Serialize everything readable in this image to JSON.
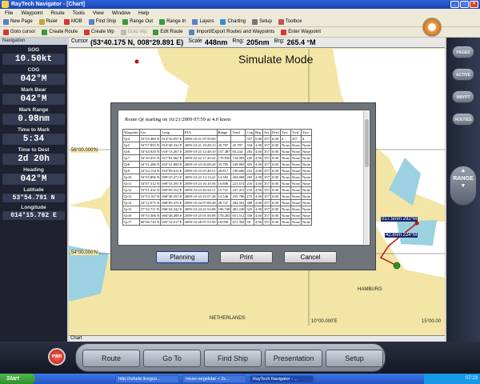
{
  "window": {
    "title": "RayTech Navigator - [Chart]"
  },
  "menu": [
    "File",
    "Waypoint",
    "Route",
    "Tools",
    "View",
    "Window",
    "Help"
  ],
  "toolbar1": [
    {
      "label": "New Page",
      "icon": "new-page-icon"
    },
    {
      "label": "Ruler",
      "icon": "ruler-icon"
    },
    {
      "label": "MOB",
      "icon": "mob-icon"
    },
    {
      "label": "Find Ship",
      "icon": "find-ship-icon"
    },
    {
      "label": "Range Out",
      "icon": "range-out-icon"
    },
    {
      "label": "Range In",
      "icon": "range-in-icon"
    },
    {
      "label": "Layers",
      "icon": "layers-icon"
    },
    {
      "label": "Charting",
      "icon": "charting-icon"
    },
    {
      "label": "Setup",
      "icon": "setup-icon"
    },
    {
      "label": "Toolbox",
      "icon": "toolbox-icon"
    }
  ],
  "toolbar2": [
    {
      "label": "Goto cursor",
      "icon": "goto-cursor-icon",
      "disabled": false
    },
    {
      "label": "Create Route",
      "icon": "create-route-icon",
      "disabled": false
    },
    {
      "label": "Create Wp",
      "icon": "create-wp-icon",
      "disabled": false
    },
    {
      "label": "Goto Wp",
      "icon": "goto-wp-icon",
      "disabled": true
    },
    {
      "label": "Edit Route",
      "icon": "edit-route-icon",
      "disabled": false
    },
    {
      "label": "Import/Export Routes and Waypoints",
      "icon": "import-export-icon",
      "disabled": false
    },
    {
      "label": "Enter Waypoint",
      "icon": "enter-waypoint-icon",
      "disabled": false
    }
  ],
  "navigation": {
    "header": "Navigation",
    "items": [
      {
        "label": "SOG",
        "value": "10.50kt"
      },
      {
        "label": "COG",
        "value": "042°M"
      },
      {
        "label": "Mark Bear",
        "value": "042°M"
      },
      {
        "label": "Mark Range",
        "value": "0.98nm"
      },
      {
        "label": "Time to Mark",
        "value": "5:34"
      },
      {
        "label": "Time to Dest",
        "value": "2d 20h"
      },
      {
        "label": "Heading",
        "value": "042°M"
      },
      {
        "label": "Latitude",
        "value": "53°54.791 N",
        "small": true
      },
      {
        "label": "Longitude",
        "value": "014°15.782 E",
        "small": true
      }
    ]
  },
  "chartbar": {
    "cursor_label": "Cursor",
    "cursor_value": "(53°40.175 N,",
    "cursor_lon": "008°29.891 E)",
    "scale_label": "Scale",
    "scale_value": "448nm",
    "rng_label": "Rng:",
    "rng_value": "205nm",
    "brg_label": "Brg:",
    "brg_value": "265.4 °M"
  },
  "chart": {
    "mode": "Simulate Mode",
    "lat_labels": [
      "56°00.000'N",
      "54°00.000'N"
    ],
    "lon_labels": [
      "10°00.000'E",
      "15°00.00"
    ],
    "place_labels": [
      "NETHERLANDS",
      "HAMBURG"
    ],
    "boat_labels": [
      "017.5mm 292°M",
      "42.8nm 224°M"
    ],
    "footer": "Chart"
  },
  "report": {
    "title": "Route Qr starting on 10/21/2009 07:59 at 4.0 knots",
    "columns": [
      "Waypoint",
      "Lat",
      "Long",
      "ETA",
      "Range",
      "Total",
      "Cog",
      "Brg",
      "Set",
      "Drift",
      "Tws",
      "Twd",
      "Twa"
    ],
    "rows": [
      [
        "Qr4",
        "53°55.480 N",
        "014°16.957 E",
        "2009-10-21 07:59:00",
        "",
        "",
        "357",
        "0.00",
        "357",
        "0.00",
        "0",
        "357",
        "0"
      ],
      [
        "Qr5",
        "54°57.855 N",
        "014°48.334 E",
        "2009-10-21 19:28:13",
        "45.787",
        "45.787",
        "334",
        "4.00",
        "357",
        "0.00",
        "None",
        "None",
        "None"
      ],
      [
        "Qr6",
        "54°44.920 N",
        "010°13.267 E",
        "2009-10-23 12:48:10",
        "157.487",
        "83.244",
        "282",
        "4.00",
        "357",
        "0.00",
        "None",
        "None",
        "None"
      ],
      [
        "Qr7",
        "54°30.455 N",
        "011°02.662 E",
        "2009-10-22 17:20:22",
        "170.839",
        "134.083",
        "220",
        "4.00",
        "357",
        "0.00",
        "None",
        "None",
        "None"
      ],
      [
        "Qr8",
        "54°31.286 N",
        "010°41.808 E",
        "2009-10-23 02:08:28",
        "35.785",
        "169.869",
        "303",
        "4.00",
        "357",
        "0.00",
        "None",
        "None",
        "None"
      ],
      [
        "Qr9",
        "54°22.154 N",
        "010°09.614 E",
        "2009-10-23 07:40:51",
        "20.817",
        "190.686",
        "241",
        "4.00",
        "357",
        "0.00",
        "None",
        "None",
        "None"
      ],
      [
        "Qr10",
        "54°55.896 N",
        "009°45.272 E",
        "2009-10-23 13:13:41",
        "14.382",
        "204.868",
        "265",
        "4.00",
        "357",
        "0.00",
        "None",
        "None",
        "None"
      ],
      [
        "Qr11",
        "54°07.312 N",
        "009°33.591 E",
        "2009-10-23 16:10:56",
        "16.806",
        "221.674",
        "216",
        "4.00",
        "357",
        "0.00",
        "None",
        "None",
        "None"
      ],
      [
        "Qr12",
        "53°51.432 N",
        "009°09.352 E",
        "2009-10-23 20:34:11",
        "15.741",
        "237.415",
        "210",
        "4.00",
        "357",
        "0.00",
        "None",
        "None",
        "None"
      ],
      [
        "Qr13",
        "53°53.167 N",
        "008°48.355 E",
        "2009-10-23 23:57:28",
        "13.546",
        "255.786",
        "275",
        "4.00",
        "357",
        "0.00",
        "None",
        "None",
        "None"
      ],
      [
        "Qr14",
        "54°12.075 N",
        "008°09.476 E",
        "2009-10-24 07:08:48",
        "28.747",
        "284.501",
        "308",
        "4.00",
        "357",
        "0.00",
        "None",
        "None",
        "None"
      ],
      [
        "Qr15",
        "57°32.711 N",
        "006°44.342 E",
        "2009-10-24 21:54:08",
        "196.748",
        "481.249",
        "325",
        "4.00",
        "357",
        "0.00",
        "None",
        "None",
        "None"
      ],
      [
        "Qr16",
        "59°53.306 N",
        "004°48.498 E",
        "2009-10-25 01:56:08",
        "170.263",
        "651.512",
        "358",
        "4.00",
        "357",
        "0.00",
        "None",
        "None",
        "None"
      ],
      [
        "Qr17",
        "60°06.743 N",
        "005°12.017 E",
        "2009-10-28 07:53:56",
        "18.090",
        "671.302",
        "58",
        "4.00",
        "357",
        "0.00",
        "None",
        "None",
        "None"
      ]
    ],
    "buttons": [
      "Planning",
      "Print",
      "Cancel"
    ]
  },
  "sidebar": {
    "buttons": [
      "PAGES",
      "ACTIVE",
      "WAYPT",
      "ROUTES"
    ],
    "range_label": "RANGE",
    "in_label": "IN",
    "out_label": "OUT"
  },
  "bottom_nav": {
    "power": "PWR",
    "buttons": [
      "Route",
      "Go To",
      "Find Ship",
      "Presentation",
      "Setup"
    ]
  },
  "taskbar": {
    "start": "Start",
    "tasks": [
      "http://rehele.livegoo...",
      "neuer-segelstar + 2c...",
      "RayTech Navigator - ..."
    ],
    "clock": "07:23"
  },
  "colors": {
    "land": "#f2e5a5",
    "sea": "#ffffff",
    "shallow": "#9bd1e0",
    "panel": "#1d2130"
  }
}
